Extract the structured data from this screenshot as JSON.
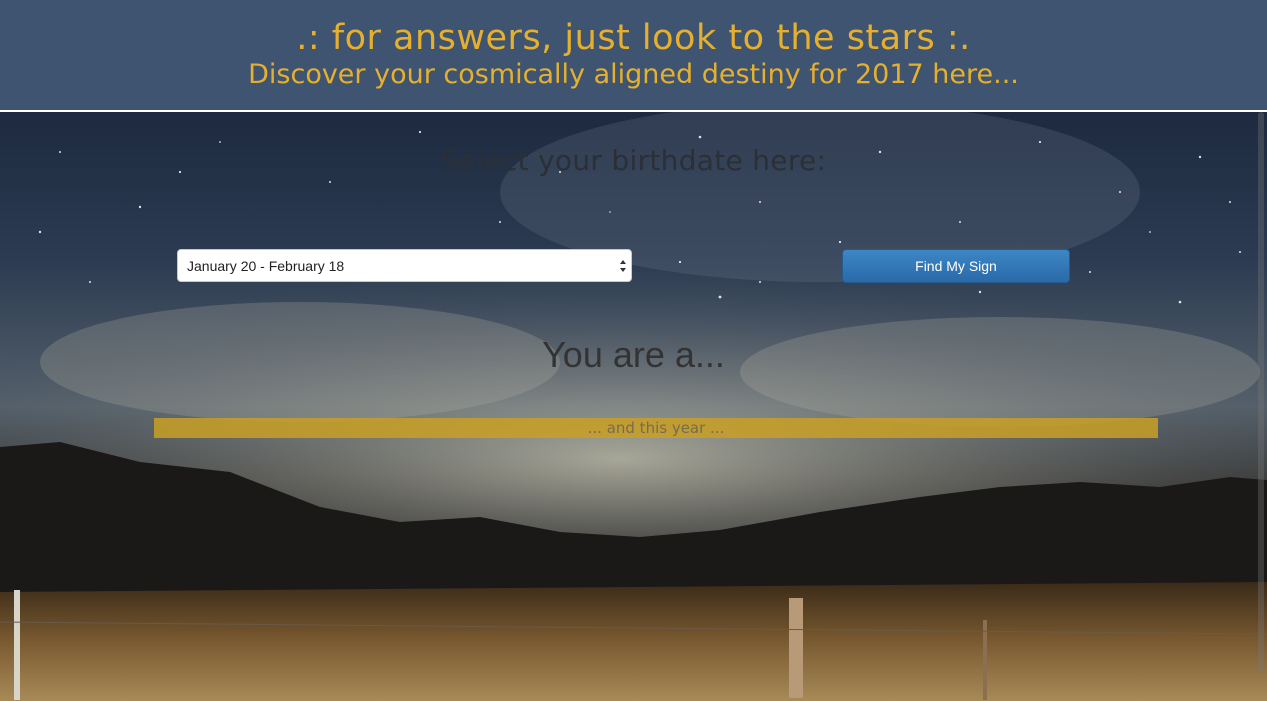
{
  "header": {
    "tagline": ".: for answers, just look to the stars :.",
    "subtitle": "Discover your cosmically aligned destiny for 2017 here..."
  },
  "main": {
    "prompt": "Select your birthdate here:",
    "birthdate_select": {
      "selected": "January 20 - February 18"
    },
    "find_button_label": "Find My Sign",
    "result_heading": "You are a...",
    "year_text": "... and this year ..."
  },
  "colors": {
    "header_bg": "#3e5470",
    "accent_gold": "#e6b02e",
    "button_blue": "#2a6aa8",
    "year_bar": "#c9a024"
  },
  "icons": {
    "select_arrows": "up-down-arrows-icon"
  }
}
